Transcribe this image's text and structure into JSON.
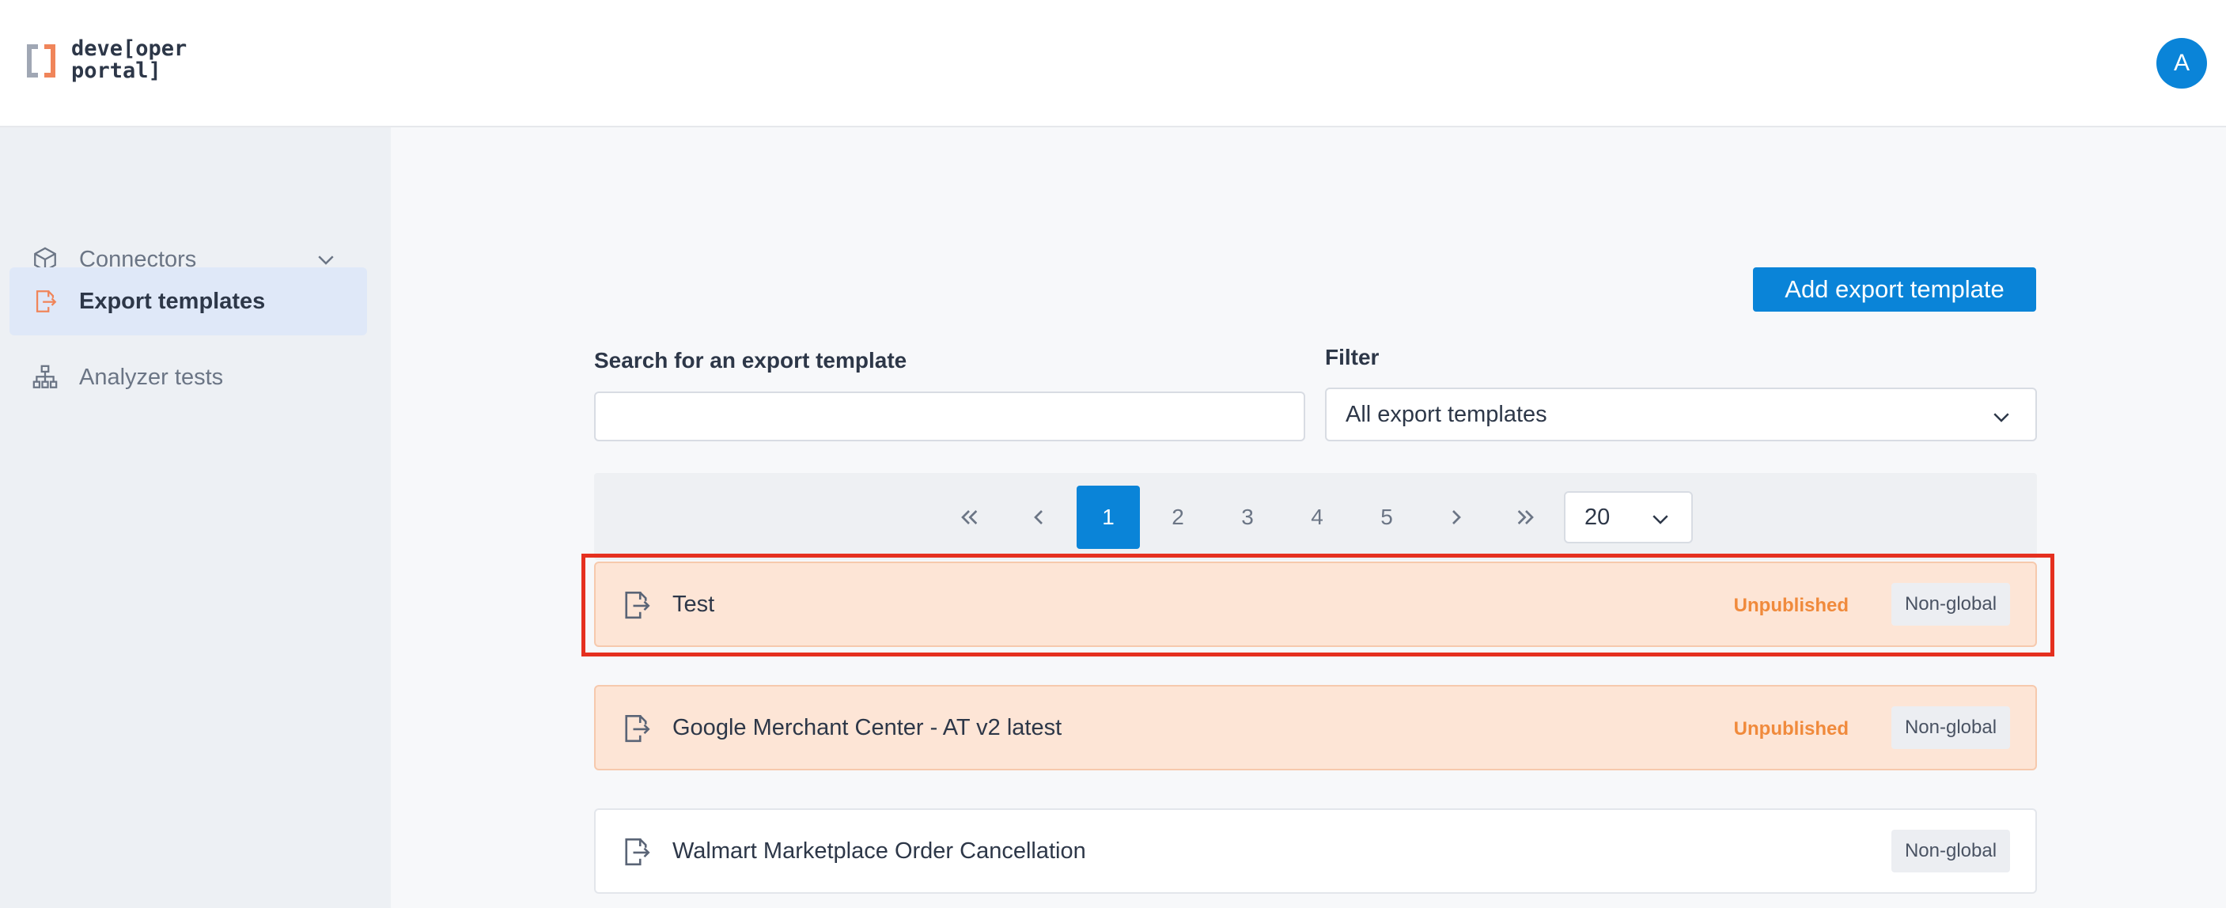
{
  "header": {
    "logo_line1": "deve[oper",
    "logo_line2": "portal]",
    "avatar_initial": "A"
  },
  "sidebar": {
    "items": [
      {
        "label": "Connectors",
        "icon": "cube-icon",
        "active": false
      },
      {
        "label": "Export templates",
        "icon": "export-file-icon",
        "active": true
      },
      {
        "label": "Analyzer tests",
        "icon": "sitemap-icon",
        "active": false
      }
    ]
  },
  "main": {
    "add_button_label": "Add export template",
    "search": {
      "label": "Search for an export template",
      "value": "",
      "placeholder": ""
    },
    "filter": {
      "label": "Filter",
      "selected": "All export templates"
    },
    "pagination": {
      "pages": [
        "1",
        "2",
        "3",
        "4",
        "5"
      ],
      "current_page": "1",
      "per_page": "20"
    },
    "templates": [
      {
        "name": "Test",
        "status": "Unpublished",
        "scope": "Non-global"
      },
      {
        "name": "Google Merchant Center - AT v2 latest",
        "status": "Unpublished",
        "scope": "Non-global"
      },
      {
        "name": "Walmart Marketplace Order Cancellation",
        "status": "",
        "scope": "Non-global"
      }
    ]
  },
  "colors": {
    "accent": "#0a84d8",
    "unpublished_text": "#f08a3c",
    "unpublished_row_bg": "#fde5d6",
    "highlight_box": "#e5301f"
  }
}
